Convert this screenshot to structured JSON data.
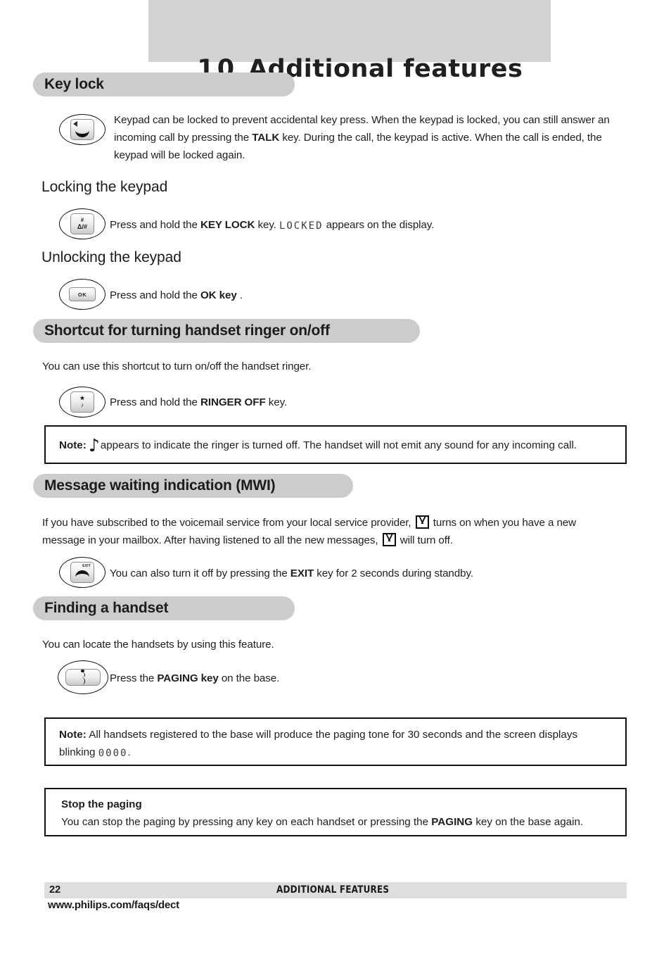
{
  "chapter": {
    "number": "10",
    "title": "Additional features"
  },
  "sections": {
    "key_lock": {
      "heading": "Key lock",
      "intro_part1": "Keypad can be locked to prevent accidental key press. When the keypad is locked, you can still answer an incoming call by pressing the ",
      "intro_bold": "TALK",
      "intro_part2": " key.  During the call, the keypad is active.  When the call is ended, the keypad will be locked again.",
      "talk_key_icon": "talk-key-icon"
    },
    "locking": {
      "heading": "Locking the keypad",
      "text_part1": "Press and hold the ",
      "text_bold": "KEY LOCK",
      "text_part2": " key. ",
      "lcd_value": "LOCKED",
      "text_part3": " appears on the display.",
      "key_icon": "key-lock-key-icon",
      "key_glyph_top": "#",
      "key_glyph_bottom": "Δ/#"
    },
    "unlocking": {
      "heading": "Unlocking the keypad",
      "text_part1": "Press and hold the ",
      "text_bold": "OK key",
      "text_part2": " .",
      "key_icon": "ok-key-icon",
      "key_label": "OK"
    },
    "ringer_shortcut": {
      "heading": "Shortcut for turning handset ringer on/off",
      "intro": "You can use this shortcut to turn on/off the handset ringer.",
      "text_part1": "Press and hold the ",
      "text_bold": "RINGER OFF",
      "text_part2": " key.",
      "key_icon": "ringer-off-key-icon",
      "key_glyph_top": "★",
      "key_glyph_bottom": "♪",
      "note": {
        "label": "Note:",
        "icon": "music-note-icon",
        "glyph": "♪",
        "text": "appears to indicate the ringer is turned off.  The handset will not emit any sound for any incoming call."
      }
    },
    "mwi": {
      "heading": "Message waiting indication (MWI)",
      "text_part1": "If you have subscribed to the voicemail service from your local service provider, ",
      "text_part2": " turns on when you have a new message in your mailbox.  After having listened to all the new messages, ",
      "text_part3": " will turn off.",
      "envelope_icon": "envelope-icon",
      "exit_text_part1": "You can also turn it off by pressing the ",
      "exit_text_bold": "EXIT",
      "exit_text_part2": " key for 2 seconds during standby.",
      "exit_key_icon": "exit-key-icon",
      "exit_key_label": "EXIT"
    },
    "finding_handset": {
      "heading": "Finding a handset",
      "intro": "You can locate the handsets by using this feature.",
      "text_part1": "Press the ",
      "text_bold": "PAGING key",
      "text_part2": " on the base.",
      "key_icon": "paging-key-icon",
      "note": {
        "label": "Note:",
        "text_part1": "  All handsets registered to the base will produce the paging tone for 30 seconds and the screen displays blinking ",
        "lcd_value": "0000",
        "text_part2": "."
      },
      "stop_box": {
        "heading": "Stop the paging",
        "text_part1": "You can stop the paging by pressing any key on each handset or pressing the ",
        "text_bold": "PAGING",
        "text_part2": " key on the base again."
      }
    }
  },
  "footer": {
    "page_number": "22",
    "center_label": "ADDITIONAL FEATURES",
    "url": "www.philips.com/faqs/dect"
  },
  "colors": {
    "band_gray": "#d2d2d2",
    "pill_gray": "#cccccc",
    "footer_gray": "#dedede",
    "text_dark": "#1a1a1a"
  }
}
